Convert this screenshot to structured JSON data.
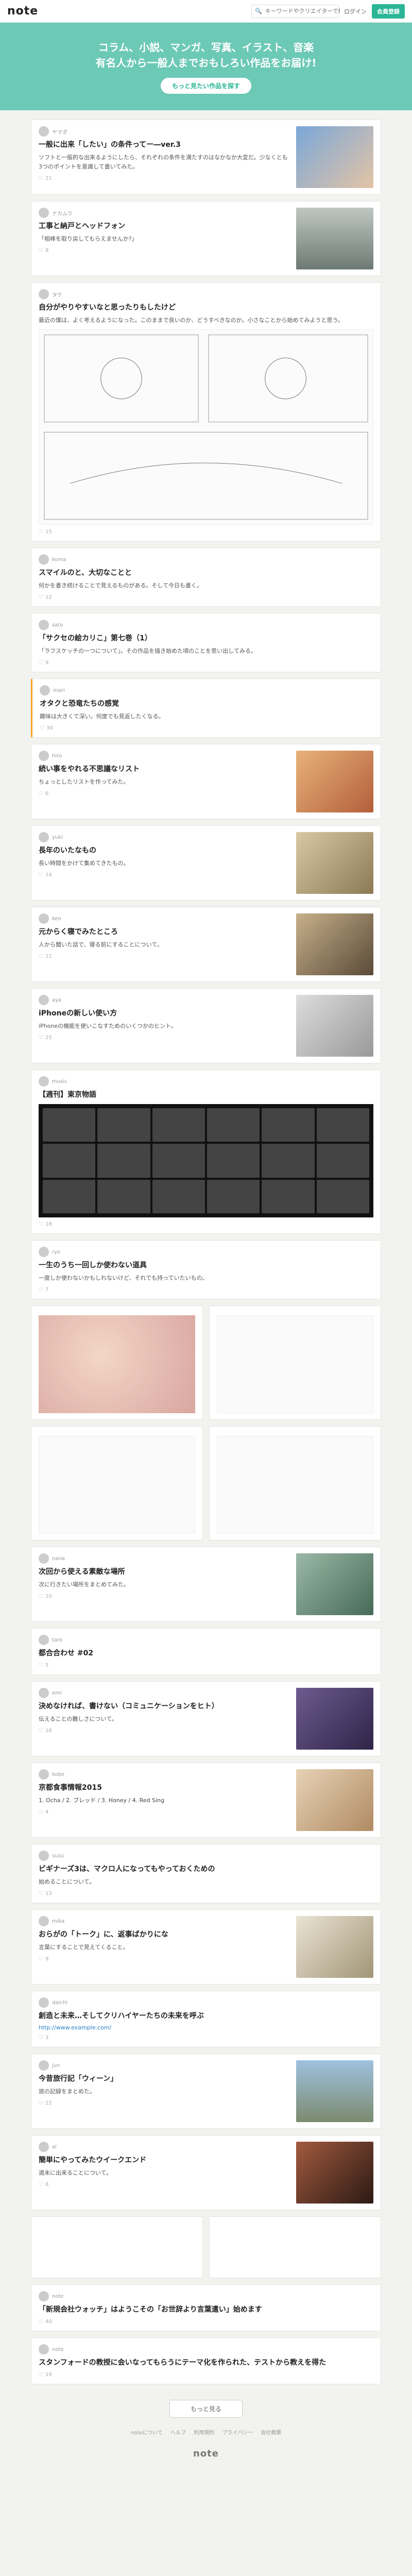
{
  "header": {
    "logo": "note",
    "search_placeholder": "キーワードやクリエイターで検索",
    "login": "ログイン",
    "signup": "会員登録"
  },
  "hero": {
    "line1": "コラム、小説、マンガ、写真、イラスト、音楽",
    "line2": "有名人から一般人までおもしろい作品をお届け!",
    "button": "もっと見たい作品を探す"
  },
  "feed": [
    {
      "author": "ヤマダ",
      "title": "一般に出来「したい」の条件ってー―ver.3",
      "body": "ソフトと一般的な出来るようにしたら、それぞれの条件を満たすのはなかなか大変だ。少なくとも3つのポイントを意識して書いてみた。",
      "likes": "21"
    },
    {
      "author": "ナカムラ",
      "title": "工事と納戸とヘッドフォン",
      "body": "「相棒を取り戻してもらえませんか?」",
      "likes": "8"
    },
    {
      "author": "タケ",
      "title": "自分がやりやすいなと思ったりもしたけど",
      "body": "最近の僕は、よく考えるようになった。このままで良いのか、どうすべきなのか。小さなことから始めてみようと思う。",
      "likes": "15"
    },
    {
      "author": "koma",
      "title": "スマイルのと、大切なことと",
      "body": "何かを書き続けることで見えるものがある。そして今日も書く。",
      "likes": "12"
    },
    {
      "author": "sato",
      "title": "「サクセの絵カリこ」第七巻（1）",
      "body": "「ラフスケッチの一つについて」。その作品を描き始めた頃のことを思い出してみる。",
      "likes": "9"
    },
    {
      "author": "mari",
      "title": "オタクと恐竜たちの感覚",
      "body": "趣味は大きくて深い。何度でも見返したくなる。",
      "likes": "30"
    },
    {
      "author": "hiro",
      "title": "続い事をやれる不思議なリスト",
      "body": "ちょっとしたリストを作ってみた。",
      "likes": "6"
    },
    {
      "author": "yuki",
      "title": "長年のいたなもの",
      "body": "長い時間をかけて集めてきたもの。",
      "likes": "14"
    },
    {
      "author": "ken",
      "title": "元からく寝でみたところ",
      "body": "人から聞いた話で、寝る前にすることについて。",
      "likes": "11"
    },
    {
      "author": "aya",
      "title": "iPhoneの新しい使い方",
      "body": "iPhoneの機能を使いこなすためのいくつかのヒント。",
      "likes": "25"
    },
    {
      "author": "music",
      "title": "【週刊】東京物語",
      "body": "",
      "likes": "18"
    },
    {
      "author": "ryo",
      "title": "一生のうち一回しか使わない道具",
      "body": "一度しか使わないかもしれないけど、それでも持っていたいもの。",
      "likes": "7"
    },
    {
      "author": "nana",
      "title": "次回から使える素敵な場所",
      "body": "次に行きたい場所をまとめてみた。",
      "likes": "10"
    },
    {
      "author": "taro",
      "title": "都合合わせ #02",
      "body": "",
      "likes": "5"
    },
    {
      "author": "emi",
      "title": "決めなければ、書けない（コミュニケーションをヒト）",
      "body": "伝えることの難しさについて。",
      "likes": "16"
    },
    {
      "author": "kobe",
      "title": "京都食事情報2015",
      "body": "1. Ocha / 2. ブレッド / 3. Honey / 4. Red Sing",
      "likes": "4"
    },
    {
      "author": "suzu",
      "title": "ビギナーズ3は、マクロ人になってもやっておくための",
      "body": "始めることについて。",
      "likes": "13"
    },
    {
      "author": "mika",
      "title": "おらがの「トーク」に、返事ばかりにな",
      "body": "言葉にすることで見えてくること。",
      "likes": "9"
    },
    {
      "author": "daichi",
      "title": "創造と未来…そしてクリハイヤーたちの未来を呼ぶ",
      "body": "http://www.example.com/",
      "likes": "3"
    },
    {
      "author": "jun",
      "title": "今昔旅行記「ウィーン」",
      "body": "旅の記録をまとめた。",
      "likes": "22"
    },
    {
      "author": "ai",
      "title": "簡単にやってみたウイークエンド",
      "body": "週末に出来ることについて。",
      "likes": "8"
    },
    {
      "author": "note",
      "title": "「新規会社ウォッチ」はようこその「お世辞より言葉遣い」始めます",
      "body": "",
      "likes": "40"
    },
    {
      "author": "note",
      "title": "スタンフォードの教授に会いなってもらうにテーマ化を作られた、テストから教えを得た",
      "body": "",
      "likes": "19"
    }
  ],
  "load_more": "もっと見る",
  "footer": {
    "links": [
      "noteについて",
      "ヘルプ",
      "利用規約",
      "プライバシー",
      "会社概要"
    ],
    "logo": "note"
  }
}
